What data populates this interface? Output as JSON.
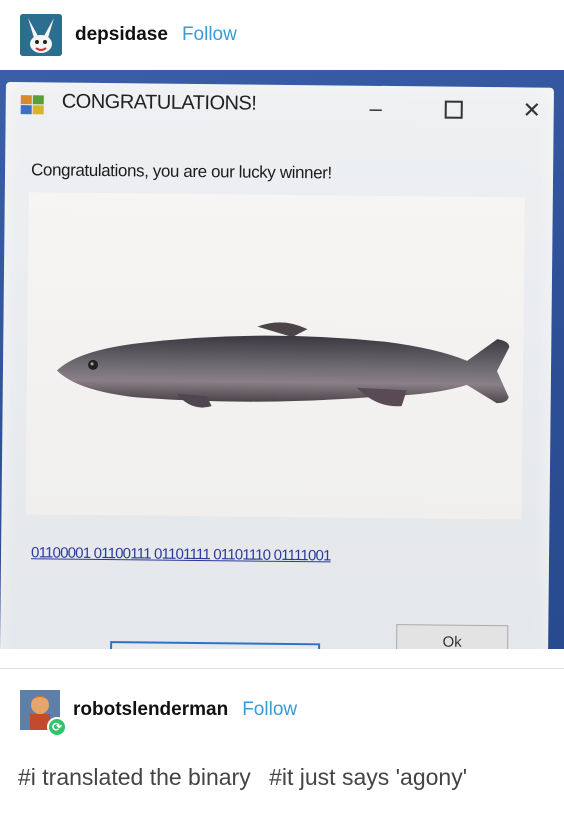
{
  "post": {
    "username": "depsidase",
    "follow_label": "Follow"
  },
  "window": {
    "title": "CONGRATULATIONS!",
    "minimize_glyph": "–",
    "close_glyph": "✕",
    "message": "Congratulations, you are our lucky winner!",
    "binary_text": "01100001 01100111 01101111 01101110 01111001",
    "ok_label": "Ok"
  },
  "reblog": {
    "username": "robotslenderman",
    "follow_label": "Follow",
    "tags": [
      "#i translated the binary",
      "#it just says 'agony'"
    ]
  },
  "colors": {
    "follow": "#3a9bd8",
    "monitor_blue": "#2e4f96",
    "reblog_green": "#2fc36b"
  },
  "icons": {
    "avatar": "rabbit-avatar-icon",
    "app": "windows-app-icon",
    "reblog": "reblog-icon"
  }
}
